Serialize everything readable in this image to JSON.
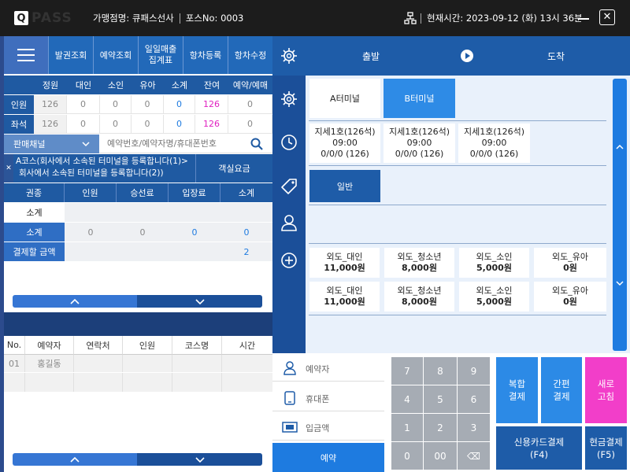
{
  "titlebar": {
    "logo_mark": "Q",
    "logo_text": "PASS",
    "store": "가맹점명: 큐패스선사",
    "pos": "포스No: 0003",
    "time": "현재시간: 2023-09-12 (화) 13시 36분",
    "close_glyph": "✕"
  },
  "nav": {
    "items": [
      "발권조회",
      "예약조회",
      "일일매출\n집계표",
      "항차등록",
      "항차수정"
    ]
  },
  "stats": {
    "headers": [
      "정원",
      "대인",
      "소인",
      "유아",
      "소계",
      "잔여",
      "예약/예매"
    ],
    "rows": [
      {
        "label": "인원",
        "values": [
          "126",
          "0",
          "0",
          "0",
          "0",
          "126",
          "0"
        ]
      },
      {
        "label": "좌석",
        "values": [
          "126",
          "0",
          "0",
          "0",
          "0",
          "126",
          "0"
        ]
      }
    ]
  },
  "search": {
    "channel": "판매채널",
    "placeholder": "예약번호/예약자명/휴대폰번호"
  },
  "course": {
    "x": "✕",
    "line1": "A코스(회사에서 소속된 터미널을 등록합니다(1)>",
    "line2": "회사에서 소속된 터미널을 등록합니다(2))",
    "guest_fee": "객실요금"
  },
  "fare": {
    "headers": [
      "권종",
      "인원",
      "승선료",
      "입장료",
      "소계"
    ],
    "subtotal_plain": "소계",
    "subtotal_blue": {
      "label": "소계",
      "values": [
        "0",
        "0",
        "0",
        "0"
      ]
    },
    "payable": {
      "label": "결제할 금액",
      "value": "2"
    }
  },
  "reservations": {
    "headers": [
      "No.",
      "예약자",
      "연락처",
      "인원",
      "코스명",
      "시간"
    ],
    "rows": [
      {
        "no": "01",
        "name": "홍길동",
        "phone": "",
        "count": "",
        "course": "",
        "time": ""
      }
    ]
  },
  "route": {
    "depart": "출발",
    "arrive": "도착"
  },
  "terminals": [
    "A터미널",
    "B터미널"
  ],
  "voyages": [
    {
      "name": "지세1호(126석)",
      "time": "09:00",
      "seats": "0/0/0 (126)"
    },
    {
      "name": "지세1호(126석)",
      "time": "09:00",
      "seats": "0/0/0 (126)"
    },
    {
      "name": "지세1호(126석)",
      "time": "09:00",
      "seats": "0/0/0 (126)"
    }
  ],
  "seat_type": "일반",
  "fares_grid": [
    {
      "name": "외도_대인",
      "price": "11,000원"
    },
    {
      "name": "외도_청소년",
      "price": "8,000원"
    },
    {
      "name": "외도_소인",
      "price": "5,000원"
    },
    {
      "name": "외도_유아",
      "price": "0원"
    },
    {
      "name": "외도_대인",
      "price": "11,000원"
    },
    {
      "name": "외도_청소년",
      "price": "8,000원"
    },
    {
      "name": "외도_소인",
      "price": "5,000원"
    },
    {
      "name": "외도_유아",
      "price": "0원"
    }
  ],
  "fields": {
    "booker": "예약자",
    "phone": "휴대폰",
    "deposit": "입금액",
    "reserve": "예약"
  },
  "keypad": [
    "7",
    "8",
    "9",
    "4",
    "5",
    "6",
    "1",
    "2",
    "3",
    "0",
    "00",
    "⌫"
  ],
  "payments": {
    "complex": "복합\n결제",
    "simple": "간편\n결제",
    "refresh": "새로\n고침",
    "card": "신용카드결제\n(F4)",
    "cash": "현금결제\n(F5)"
  },
  "colors": {
    "primary": "#1e5ca8",
    "accent_blue": "#1e7be0",
    "pink": "#e020c0",
    "magenta_button": "#f23ec9"
  }
}
